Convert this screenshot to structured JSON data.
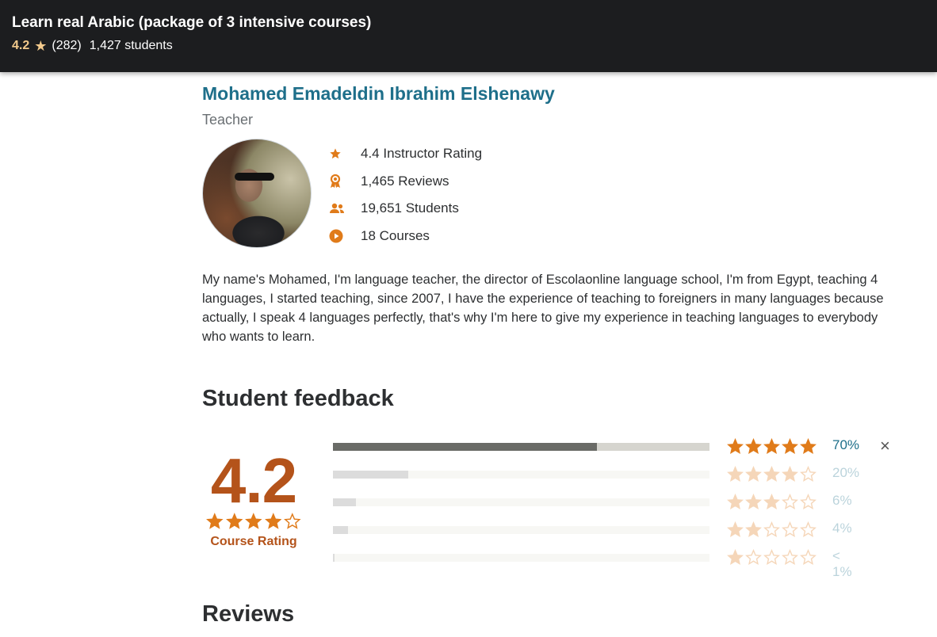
{
  "header": {
    "title": "Learn real Arabic (package of 3 intensive courses)",
    "rating": "4.2",
    "rating_count": "(282)",
    "students": "1,427 students"
  },
  "instructor": {
    "name": "Mohamed Emadeldin Ibrahim Elshenawy",
    "job_title": "Teacher",
    "stats": [
      {
        "icon": "star-icon",
        "text": "4.4 Instructor Rating"
      },
      {
        "icon": "award-icon",
        "text": "1,465 Reviews"
      },
      {
        "icon": "users-icon",
        "text": "19,651 Students"
      },
      {
        "icon": "play-circle-icon",
        "text": "18 Courses"
      }
    ],
    "bio": "My name's Mohamed, I'm language teacher, the director of Escolaonline language school, I'm from Egypt, teaching 4 languages, I started teaching, since 2007, I have the experience of teaching to foreigners in many languages because actually, I speak 4 languages perfectly, that's why I'm here to give my experience in teaching languages to everybody who wants to learn."
  },
  "feedback": {
    "title": "Student feedback",
    "rating": "4.2",
    "rating_stars": 4.2,
    "rating_label": "Course Rating",
    "rows": [
      {
        "stars": 5,
        "percent": 70,
        "label": "70%",
        "active": true
      },
      {
        "stars": 4,
        "percent": 20,
        "label": "20%",
        "active": false
      },
      {
        "stars": 3,
        "percent": 6,
        "label": "6%",
        "active": false
      },
      {
        "stars": 2,
        "percent": 4,
        "label": "4%",
        "active": false
      },
      {
        "stars": 1,
        "percent": 0.5,
        "label": "< 1%",
        "active": false
      }
    ],
    "close_label": "×"
  },
  "reviews": {
    "title": "Reviews"
  },
  "colors": {
    "accent_orange": "#e59819",
    "rating_dark": "#b4531a",
    "link_teal": "#1e6f8a"
  }
}
